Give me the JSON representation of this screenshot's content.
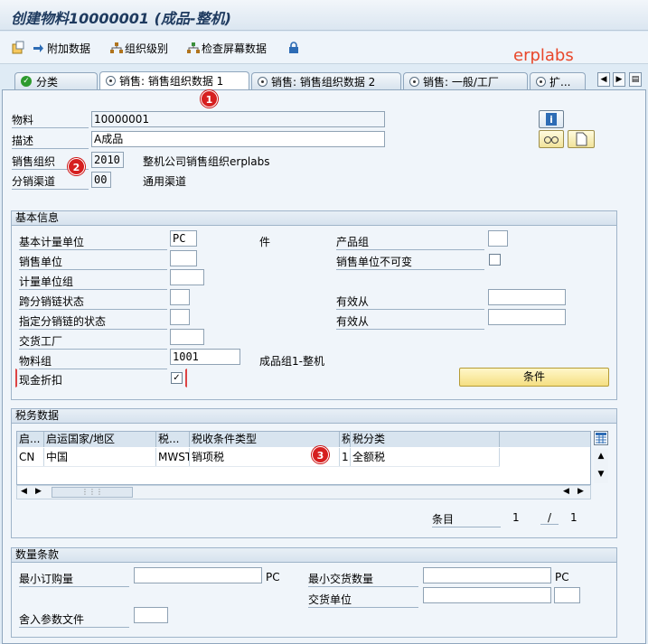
{
  "window": {
    "title": "创建物料10000001 (成品-整机)"
  },
  "toolbar": {
    "additional_data": "附加数据",
    "org_levels": "组织级别",
    "check_screen": "检查屏幕数据"
  },
  "brand": "erplabs",
  "tabs": [
    "分类",
    "销售: 销售组织数据 1",
    "销售: 销售组织数据 2",
    "销售: 一般/工厂",
    "扩..."
  ],
  "header": {
    "material_label": "物料",
    "material_value": "10000001",
    "desc_label": "描述",
    "desc_value": "A成品",
    "sales_org_label": "销售组织",
    "sales_org_value": "2010",
    "sales_org_text": "整机公司销售组织erplabs",
    "dist_channel_label": "分销渠道",
    "dist_channel_value": "00",
    "dist_channel_text": "通用渠道"
  },
  "basic": {
    "title": "基本信息",
    "base_uom_label": "基本计量单位",
    "base_uom_value": "PC",
    "base_uom_text": "件",
    "product_group_label": "产品组",
    "sales_unit_label": "销售单位",
    "sales_unit_fixed_label": "销售单位不可变",
    "uom_group_label": "计量单位组",
    "xdist_status_label": "跨分销链状态",
    "valid_from_label_1": "有效从",
    "dist_status_label": "指定分销链的状态",
    "valid_from_label_2": "有效从",
    "delivering_plant_label": "交货工厂",
    "material_group_label": "物料组",
    "material_group_value": "1001",
    "material_group_text": "成品组1-整机",
    "cash_discount_label": "现金折扣",
    "cash_discount_checked": "✓",
    "conditions_button": "条件"
  },
  "tax": {
    "title": "税务数据",
    "columns": [
      "启...",
      "启运国家/地区",
      "税...",
      "税收条件类型",
      "税",
      "税分类"
    ],
    "rows": [
      {
        "c0": "CN",
        "c1": "中国",
        "c2": "MWST",
        "c3": "销项税",
        "c4": "1",
        "c5": "全额税"
      }
    ],
    "entries_label": "条目",
    "entries_current": "1",
    "entries_sep": "/",
    "entries_total": "1"
  },
  "qty": {
    "title": "数量条款",
    "min_order_label": "最小订购量",
    "min_order_unit": "PC",
    "min_delivery_label": "最小交货数量",
    "min_delivery_unit": "PC",
    "delivery_unit_label": "交货单位",
    "rounding_label": "舍入参数文件"
  },
  "badges": [
    "1",
    "2",
    "3"
  ],
  "colors": {
    "badge": "#d61f1f",
    "brand": "#e8472a",
    "title": "#1e3a5f"
  }
}
